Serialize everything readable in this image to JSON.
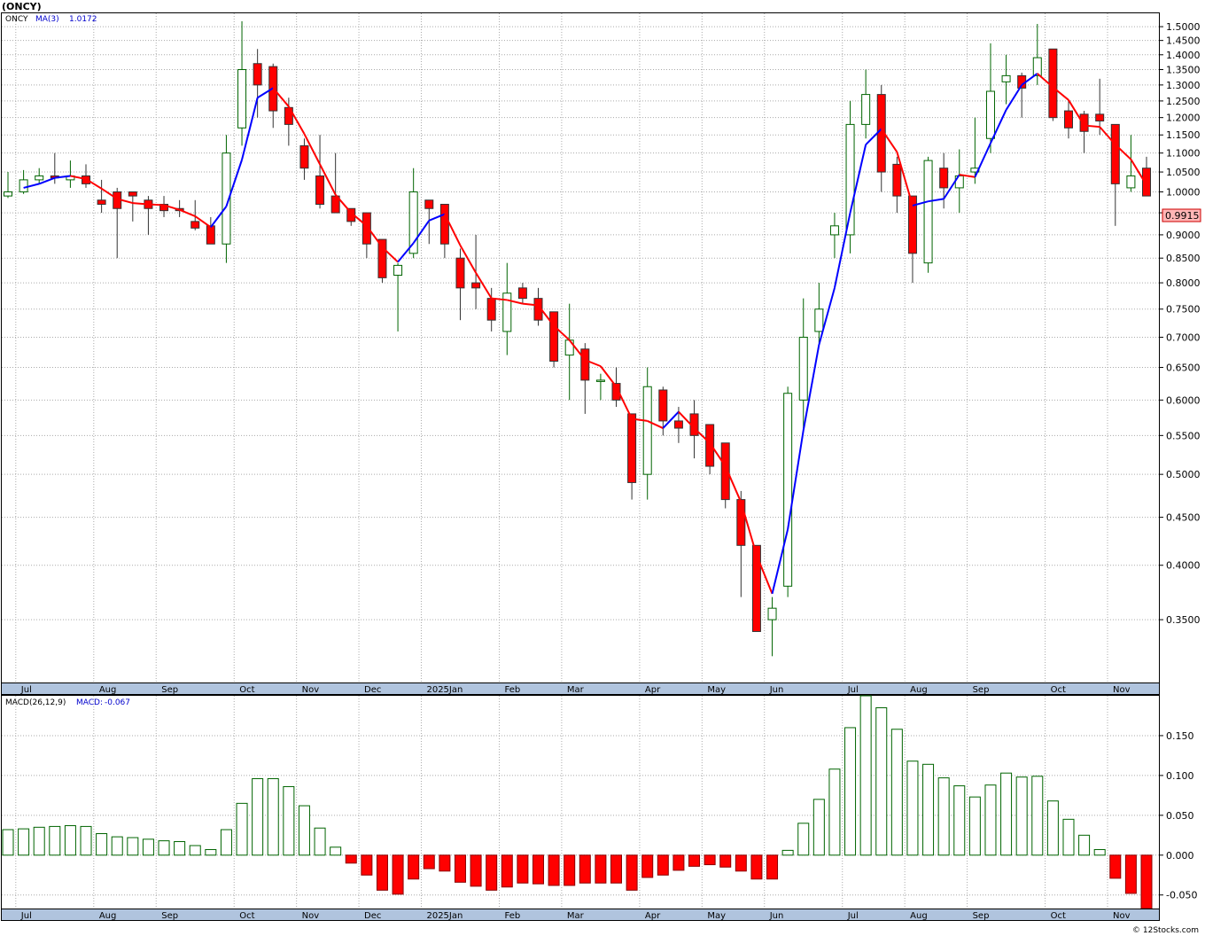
{
  "title": "(ONCY)",
  "credit": "© 12Stocks.com",
  "colors": {
    "up": "#006400",
    "down": "#ff0000",
    "ma_up": "#0000ff",
    "ma_down": "#ff0000",
    "axisbar": "#b0c4de"
  },
  "chart_data": [
    {
      "type": "candlestick",
      "panel": "price",
      "legend": {
        "symbol": "ONCY",
        "ma_label": "MA(3)",
        "ma_value": "1.0172"
      },
      "last_price": "0.9915",
      "ylim": [
        0.3,
        1.55
      ],
      "scale": "log",
      "yticks": [
        "1.5000",
        "1.4500",
        "1.4000",
        "1.3500",
        "1.3000",
        "1.2500",
        "1.2000",
        "1.1500",
        "1.1000",
        "1.0500",
        "1.0000",
        "0.9500",
        "0.9000",
        "0.8500",
        "0.8000",
        "0.7500",
        "0.7000",
        "0.6500",
        "0.6000",
        "0.5500",
        "0.5000",
        "0.4500",
        "0.4000",
        "0.3500"
      ],
      "months": [
        {
          "label": "Jul",
          "week": 1
        },
        {
          "label": "Aug",
          "week": 6
        },
        {
          "label": "Sep",
          "week": 10
        },
        {
          "label": "Oct",
          "week": 15
        },
        {
          "label": "Nov",
          "week": 19
        },
        {
          "label": "Dec",
          "week": 23
        },
        {
          "label": "2025Jan",
          "week": 27
        },
        {
          "label": "Feb",
          "week": 32
        },
        {
          "label": "Mar",
          "week": 36
        },
        {
          "label": "Apr",
          "week": 41
        },
        {
          "label": "May",
          "week": 45
        },
        {
          "label": "Jun",
          "week": 49
        },
        {
          "label": "Jul",
          "week": 54
        },
        {
          "label": "Aug",
          "week": 58
        },
        {
          "label": "Sep",
          "week": 62
        },
        {
          "label": "Oct",
          "week": 67
        },
        {
          "label": "Nov",
          "week": 71
        }
      ],
      "candles": [
        [
          0.99,
          1.05,
          0.985,
          1.0
        ],
        [
          1.0,
          1.055,
          0.995,
          1.03
        ],
        [
          1.03,
          1.06,
          1.02,
          1.04
        ],
        [
          1.04,
          1.1,
          1.02,
          1.035
        ],
        [
          1.03,
          1.08,
          1.01,
          1.04
        ],
        [
          1.04,
          1.07,
          1.01,
          1.02
        ],
        [
          0.98,
          1.03,
          0.95,
          0.97
        ],
        [
          1.0,
          1.01,
          0.85,
          0.96
        ],
        [
          1.0,
          1.0,
          0.93,
          0.99
        ],
        [
          0.98,
          0.99,
          0.9,
          0.96
        ],
        [
          0.97,
          0.99,
          0.94,
          0.955
        ],
        [
          0.96,
          0.98,
          0.94,
          0.955
        ],
        [
          0.93,
          0.98,
          0.91,
          0.915
        ],
        [
          0.92,
          0.94,
          0.88,
          0.88
        ],
        [
          0.88,
          1.15,
          0.84,
          1.1
        ],
        [
          1.17,
          1.52,
          1.12,
          1.35
        ],
        [
          1.37,
          1.42,
          1.2,
          1.3
        ],
        [
          1.36,
          1.37,
          1.17,
          1.22
        ],
        [
          1.23,
          1.26,
          1.12,
          1.18
        ],
        [
          1.12,
          1.14,
          1.03,
          1.06
        ],
        [
          1.04,
          1.15,
          0.96,
          0.97
        ],
        [
          0.99,
          1.1,
          0.95,
          0.95
        ],
        [
          0.96,
          0.96,
          0.92,
          0.93
        ],
        [
          0.95,
          0.95,
          0.85,
          0.88
        ],
        [
          0.89,
          0.89,
          0.8,
          0.81
        ],
        [
          0.815,
          0.84,
          0.71,
          0.835
        ],
        [
          0.86,
          1.06,
          0.85,
          1.0
        ],
        [
          0.98,
          0.98,
          0.88,
          0.96
        ],
        [
          0.97,
          0.97,
          0.85,
          0.88
        ],
        [
          0.85,
          0.87,
          0.73,
          0.79
        ],
        [
          0.8,
          0.9,
          0.75,
          0.79
        ],
        [
          0.77,
          0.79,
          0.71,
          0.73
        ],
        [
          0.71,
          0.84,
          0.67,
          0.78
        ],
        [
          0.79,
          0.8,
          0.76,
          0.77
        ],
        [
          0.77,
          0.79,
          0.72,
          0.73
        ],
        [
          0.745,
          0.745,
          0.65,
          0.66
        ],
        [
          0.67,
          0.76,
          0.6,
          0.695
        ],
        [
          0.68,
          0.69,
          0.58,
          0.63
        ],
        [
          0.63,
          0.64,
          0.6,
          0.63
        ],
        [
          0.625,
          0.65,
          0.59,
          0.6
        ],
        [
          0.58,
          0.58,
          0.47,
          0.49
        ],
        [
          0.5,
          0.65,
          0.47,
          0.62
        ],
        [
          0.615,
          0.62,
          0.55,
          0.57
        ],
        [
          0.57,
          0.59,
          0.54,
          0.56
        ],
        [
          0.58,
          0.6,
          0.52,
          0.55
        ],
        [
          0.565,
          0.565,
          0.5,
          0.51
        ],
        [
          0.54,
          0.54,
          0.46,
          0.47
        ],
        [
          0.47,
          0.48,
          0.37,
          0.42
        ],
        [
          0.42,
          0.42,
          0.34,
          0.34
        ],
        [
          0.35,
          0.37,
          0.32,
          0.36
        ],
        [
          0.38,
          0.62,
          0.37,
          0.61
        ],
        [
          0.6,
          0.77,
          0.56,
          0.7
        ],
        [
          0.71,
          0.8,
          0.69,
          0.75
        ],
        [
          0.9,
          0.95,
          0.85,
          0.92
        ],
        [
          0.9,
          1.25,
          0.86,
          1.18
        ],
        [
          1.18,
          1.35,
          1.14,
          1.27
        ],
        [
          1.27,
          1.3,
          1.0,
          1.05
        ],
        [
          1.07,
          1.09,
          0.95,
          0.99
        ],
        [
          0.99,
          0.99,
          0.8,
          0.86
        ],
        [
          0.84,
          1.09,
          0.82,
          1.08
        ],
        [
          1.06,
          1.1,
          0.96,
          1.01
        ],
        [
          1.01,
          1.11,
          0.95,
          1.04
        ],
        [
          1.05,
          1.2,
          1.02,
          1.06
        ],
        [
          1.14,
          1.44,
          1.1,
          1.28
        ],
        [
          1.31,
          1.4,
          1.24,
          1.33
        ],
        [
          1.33,
          1.34,
          1.2,
          1.29
        ],
        [
          1.33,
          1.51,
          1.3,
          1.39
        ],
        [
          1.42,
          1.42,
          1.19,
          1.2
        ],
        [
          1.22,
          1.25,
          1.14,
          1.17
        ],
        [
          1.21,
          1.22,
          1.1,
          1.16
        ],
        [
          1.21,
          1.32,
          1.15,
          1.19
        ],
        [
          1.18,
          1.18,
          0.92,
          1.02
        ],
        [
          1.01,
          1.15,
          1.0,
          1.04
        ],
        [
          1.06,
          1.09,
          0.99,
          0.99
        ]
      ],
      "ma": [
        null,
        1.01,
        1.02,
        1.035,
        1.04,
        1.032,
        1.008,
        0.983,
        0.973,
        0.97,
        0.968,
        0.957,
        0.942,
        0.917,
        0.965,
        1.082,
        1.26,
        1.29,
        1.233,
        1.153,
        1.07,
        0.993,
        0.95,
        0.92,
        0.873,
        0.842,
        0.882,
        0.932,
        0.947,
        0.877,
        0.82,
        0.77,
        0.767,
        0.76,
        0.757,
        0.72,
        0.695,
        0.662,
        0.652,
        0.62,
        0.573,
        0.57,
        0.56,
        0.583,
        0.56,
        0.54,
        0.51,
        0.467,
        0.41,
        0.373,
        0.437,
        0.557,
        0.687,
        0.79,
        0.95,
        1.123,
        1.167,
        1.103,
        0.967,
        0.977,
        0.983,
        1.043,
        1.037,
        1.127,
        1.223,
        1.3,
        1.337,
        1.293,
        1.253,
        1.177,
        1.173,
        1.123,
        1.083,
        1.017
      ]
    },
    {
      "type": "bar",
      "panel": "macd",
      "legend": {
        "label": "MACD(26,12,9)",
        "value_label": "MACD:",
        "value": "-0.067"
      },
      "ylim": [
        -0.067,
        0.2
      ],
      "yticks": [
        "0.150",
        "0.100",
        "0.050",
        "0.000",
        "-0.050"
      ],
      "values": [
        0.032,
        0.033,
        0.035,
        0.036,
        0.037,
        0.036,
        0.027,
        0.023,
        0.022,
        0.02,
        0.018,
        0.017,
        0.012,
        0.007,
        0.032,
        0.065,
        0.096,
        0.096,
        0.086,
        0.062,
        0.034,
        0.01,
        -0.01,
        -0.025,
        -0.044,
        -0.049,
        -0.03,
        -0.017,
        -0.02,
        -0.034,
        -0.039,
        -0.044,
        -0.04,
        -0.035,
        -0.036,
        -0.038,
        -0.038,
        -0.035,
        -0.035,
        -0.035,
        -0.044,
        -0.028,
        -0.025,
        -0.019,
        -0.014,
        -0.012,
        -0.015,
        -0.02,
        -0.03,
        -0.03,
        0.006,
        0.04,
        0.07,
        0.108,
        0.16,
        0.2,
        0.185,
        0.158,
        0.118,
        0.114,
        0.097,
        0.087,
        0.073,
        0.088,
        0.103,
        0.098,
        0.099,
        0.068,
        0.045,
        0.025,
        0.007,
        -0.029,
        -0.048,
        -0.067
      ]
    }
  ]
}
